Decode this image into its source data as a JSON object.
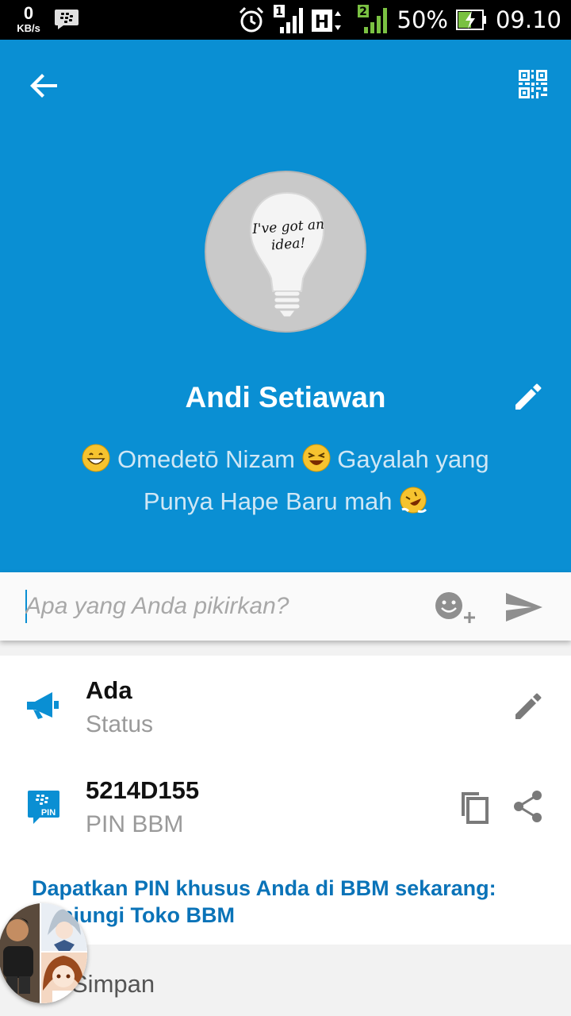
{
  "status_bar": {
    "net_speed": "0",
    "net_unit": "KB/s",
    "sim1_label": "1",
    "network_type": "H",
    "sim2_label": "2",
    "battery": "50%",
    "time": "09.10",
    "icons": [
      "bbm-notification-icon",
      "alarm-icon",
      "signal-icon",
      "battery-charging-icon"
    ]
  },
  "header": {
    "back_icon": "arrow-left-icon",
    "qr_icon": "qr-code-icon",
    "avatar_caption": "I've got an idea!",
    "name": "Andi Setiawan",
    "edit_icon": "pencil-icon",
    "status_part1": "Omedetō Nizam",
    "status_part2": "Gayalah yang",
    "status_part3": "Punya Hape Baru mah",
    "accent_color": "#0a8fd3"
  },
  "compose": {
    "placeholder": "Apa yang Anda pikirkan?",
    "emoji_icon": "emoji-add-icon",
    "send_icon": "send-icon"
  },
  "info": {
    "availability": {
      "value": "Ada",
      "label": "Status",
      "icon": "megaphone-icon",
      "action_icon": "pencil-icon"
    },
    "pin": {
      "value": "5214D155",
      "label": "PIN BBM",
      "icon": "bbm-pin-icon",
      "badge": "PIN",
      "copy_icon": "copy-icon",
      "share_icon": "share-icon"
    },
    "promo_line1": "Dapatkan PIN khusus Anda di BBM sekarang:",
    "promo_line2": "Kunjungi Toko BBM"
  },
  "bottom": {
    "label": "Simpan"
  }
}
